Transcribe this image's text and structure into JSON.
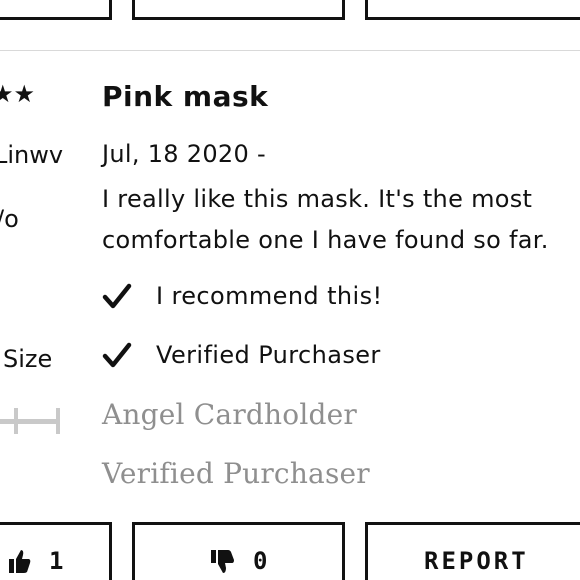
{
  "top_buttons": {
    "b1": "",
    "b2": "",
    "b3": ""
  },
  "left": {
    "stars": "★★",
    "reviewer": "Linwv",
    "location": "/o",
    "size_label": "Size",
    "size_slider_position": 0.5
  },
  "review": {
    "title": "Pink mask",
    "date": "Jul, 18 2020 -",
    "body_lines": [
      "I really like this mask. It's the most",
      "comfortable one I have found so far."
    ],
    "recommend": "I recommend this!",
    "verified": "Verified Purchaser",
    "byline": "Angel Cardholder",
    "verified_secondary": "Verified Purchaser"
  },
  "actions": {
    "helpful_count": "1",
    "unhelpful_count": "0",
    "report_label": "REPORT"
  },
  "icons": {
    "check": "checkmark-icon",
    "thumbs_up": "thumbs-up-icon",
    "thumbs_down": "thumbs-down-icon"
  }
}
